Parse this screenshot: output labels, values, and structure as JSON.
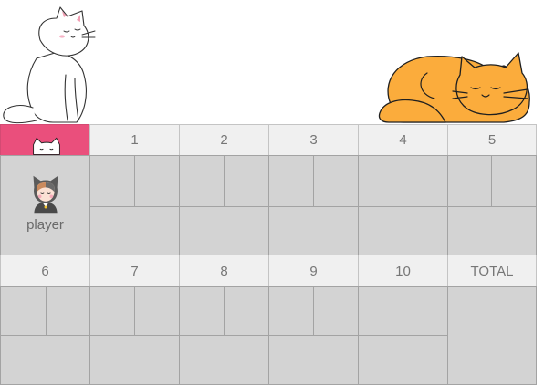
{
  "top_frames": [
    "1",
    "2",
    "3",
    "4",
    "5"
  ],
  "bottom_frames": [
    "6",
    "7",
    "8",
    "9",
    "10"
  ],
  "total_label": "TOTAL",
  "player": {
    "name": "player"
  },
  "colors": {
    "accent": "#ea4f7c",
    "header_bg": "#f0f0f0",
    "score_bg": "#d3d3d3",
    "cat_orange": "#fbac3c"
  },
  "icons": [
    "white-cat-icon",
    "sleeping-orange-cat-icon",
    "peeking-cat-icon",
    "player-avatar-icon"
  ]
}
